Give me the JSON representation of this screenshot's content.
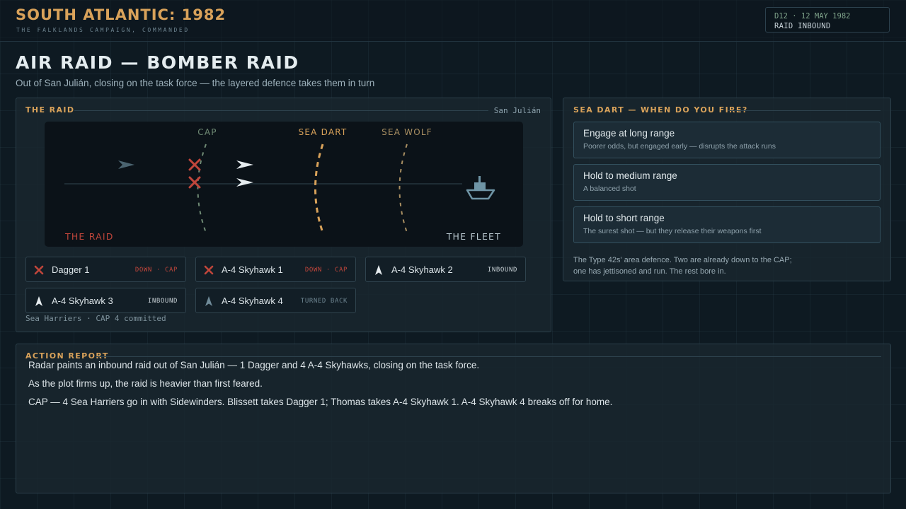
{
  "header": {
    "title": "SOUTH ATLANTIC: 1982",
    "subtitle": "THE FALKLANDS CAMPAIGN, COMMANDED",
    "status_date": "D12 · 12 MAY 1982",
    "status_state": "RAID INBOUND"
  },
  "page": {
    "title": "AIR RAID — BOMBER RAID",
    "subtitle": "Out of San Julián, closing on the task force — the layered defence takes them in turn"
  },
  "raid_panel": {
    "heading": "THE RAID",
    "origin": "San Julián",
    "map": {
      "zones": [
        "CAP",
        "SEA DART",
        "SEA WOLF"
      ],
      "left_label": "THE RAID",
      "right_label": "THE FLEET"
    },
    "aircraft": [
      {
        "name": "Dagger 1",
        "status": "DOWN · CAP",
        "state": "down"
      },
      {
        "name": "A-4 Skyhawk 1",
        "status": "DOWN · CAP",
        "state": "down"
      },
      {
        "name": "A-4 Skyhawk 2",
        "status": "INBOUND",
        "state": "inbound"
      },
      {
        "name": "A-4 Skyhawk 3",
        "status": "INBOUND",
        "state": "inbound"
      },
      {
        "name": "A-4 Skyhawk 4",
        "status": "TURNED BACK",
        "state": "turned"
      }
    ],
    "cap_note": "Sea Harriers · CAP 4 committed"
  },
  "sea_dart": {
    "heading": "SEA DART — WHEN DO YOU FIRE?",
    "options": [
      {
        "label": "Engage at long range",
        "desc": "Poorer odds, but engaged early — disrupts the attack runs"
      },
      {
        "label": "Hold to medium range",
        "desc": "A balanced shot"
      },
      {
        "label": "Hold to short range",
        "desc": "The surest shot — but they release their weapons first"
      }
    ],
    "note_line1": "The Type 42s' area defence. Two are already down to the CAP;",
    "note_line2": "one has jettisoned and run. The rest bore in."
  },
  "report": {
    "heading": "ACTION REPORT",
    "lines": [
      "Radar paints an inbound raid out of San Julián — 1 Dagger and 4 A-4 Skyhawks, closing on the task force.",
      "As the plot firms up, the raid is heavier than first feared.",
      "CAP — 4 Sea Harriers go in with Sidewinders. Blissett takes Dagger 1; Thomas takes A-4 Skyhawk 1. A-4 Skyhawk 4 breaks off for home."
    ]
  },
  "colors": {
    "accent": "#d9a25a",
    "down": "#c0463b",
    "cap_arc": "#6f8a74",
    "sea_dart_arc": "#d9a25a",
    "sea_wolf_arc": "#a98f62",
    "fleet": "#6f95a6"
  }
}
